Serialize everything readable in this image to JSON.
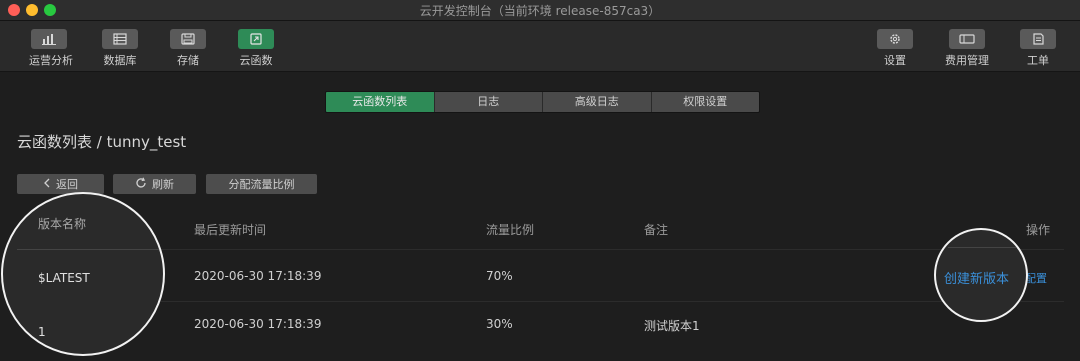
{
  "window": {
    "title": "云开发控制台（当前环境 release-857ca3）"
  },
  "toolbar": {
    "left": [
      {
        "label": "运营分析",
        "icon": "bar-chart-icon",
        "active": false
      },
      {
        "label": "数据库",
        "icon": "database-icon",
        "active": false
      },
      {
        "label": "存储",
        "icon": "storage-icon",
        "active": false
      },
      {
        "label": "云函数",
        "icon": "cloud-function-icon",
        "active": true
      }
    ],
    "right": [
      {
        "label": "设置",
        "icon": "gear-icon"
      },
      {
        "label": "费用管理",
        "icon": "billing-icon"
      },
      {
        "label": "工单",
        "icon": "ticket-icon"
      }
    ]
  },
  "tabs": [
    {
      "label": "云函数列表",
      "active": true
    },
    {
      "label": "日志",
      "active": false
    },
    {
      "label": "高级日志",
      "active": false
    },
    {
      "label": "权限设置",
      "active": false
    }
  ],
  "page": {
    "title": "云函数列表 / tunny_test"
  },
  "actions": {
    "back": "返回",
    "refresh": "刷新",
    "traffic": "分配流量比例"
  },
  "table": {
    "headers": [
      "版本名称",
      "最后更新时间",
      "流量比例",
      "备注",
      "操作"
    ],
    "rows": [
      {
        "name": "$LATEST",
        "updated": "2020-06-30 17:18:39",
        "ratio": "70%",
        "note": "",
        "action_create": "创建新版本",
        "action_config": "配置"
      },
      {
        "name": "1",
        "updated": "2020-06-30 17:18:39",
        "ratio": "30%",
        "note": "测试版本1",
        "action_create": "",
        "action_config": ""
      }
    ]
  },
  "colors": {
    "accent_green": "#2e8b57",
    "link_blue": "#3a8fd8",
    "background": "#1e1e1e"
  }
}
